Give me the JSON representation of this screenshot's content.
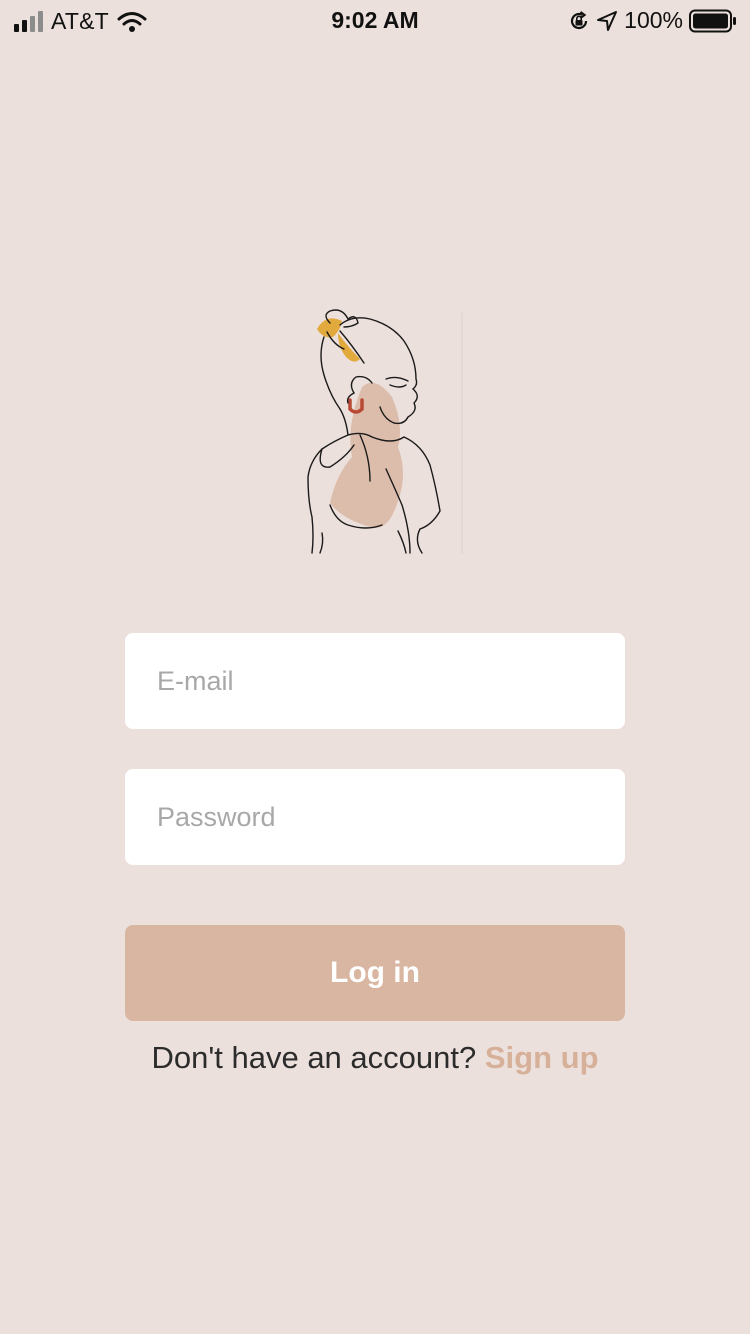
{
  "status_bar": {
    "carrier": "AT&T",
    "time": "9:02 AM",
    "battery_percent": "100%",
    "icons": [
      "signal-icon",
      "wifi-icon",
      "rotation-lock-icon",
      "location-icon",
      "battery-icon"
    ]
  },
  "illustration": {
    "name": "woman-line-art-illustration",
    "colors": {
      "line": "#1a1a1a",
      "skin_patch": "#d7b09a",
      "scrunchie": "#e2a93c",
      "earring": "#b84a35"
    }
  },
  "form": {
    "email_placeholder": "E-mail",
    "password_placeholder": "Password",
    "login_label": "Log in"
  },
  "signup": {
    "prompt": "Don't have an account?",
    "link_label": "Sign up"
  },
  "colors": {
    "background": "#ece0dc",
    "input_background": "#ffffff",
    "button": "#d8b6a1",
    "accent": "#d7b09a"
  }
}
